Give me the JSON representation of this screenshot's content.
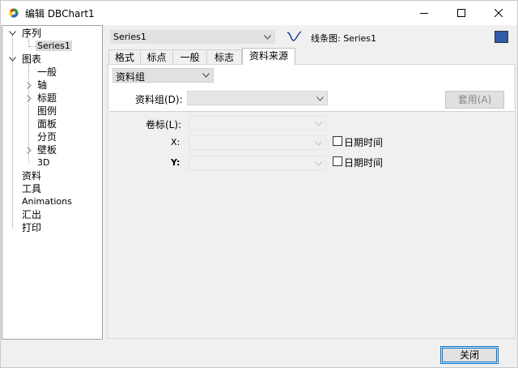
{
  "window": {
    "title": "编辑 DBChart1"
  },
  "tree": {
    "series_group": "序列",
    "series1": "Series1",
    "chart_group": "图表",
    "chart_children": [
      "一般",
      "轴",
      "标题",
      "图例",
      "面板",
      "分页",
      "壁板",
      "3D"
    ],
    "others": [
      "资料",
      "工具",
      "Animations",
      "汇出",
      "打印"
    ]
  },
  "series_bar": {
    "selected_series": "Series1",
    "series_type_label": "线条图: Series1",
    "series_color": "#2e5ca8"
  },
  "tabs": [
    "格式",
    "标点",
    "一般",
    "标志",
    "资料来源"
  ],
  "active_tab": "资料来源",
  "datasource": {
    "source_type": "资料组",
    "dataset_label": "资料组(D):",
    "dataset_value": "",
    "apply_label": "套用(A)",
    "labels_label": "卷标(L):",
    "x_label": "X:",
    "y_label": "Y:",
    "x_datetime_label": "日期时间",
    "y_datetime_label": "日期时间",
    "x_datetime_checked": false,
    "y_datetime_checked": false
  },
  "footer": {
    "close_label": "关闭"
  }
}
